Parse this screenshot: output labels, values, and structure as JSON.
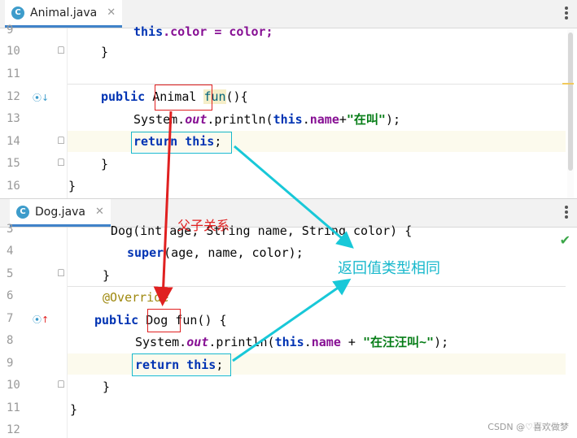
{
  "colors": {
    "keyword": "#0033b3",
    "field": "#871094",
    "string": "#067d17",
    "annotation": "#9e880d",
    "note_red": "#e02020",
    "note_cyan": "#18b8cc"
  },
  "pane_animal": {
    "tab_label": "Animal.java",
    "tab_icon": "C",
    "close_glyph": "✕",
    "line_numbers": [
      "9",
      "10",
      "11",
      "12",
      "13",
      "14",
      "15",
      "16"
    ],
    "lines": {
      "l9_a": "this",
      "l9_b": ".color = color;",
      "l10": "}",
      "l12_kw": "public",
      "l12_type": "Animal",
      "l12_fn": "fun",
      "l12_rest": "(){",
      "l13_a": "System.",
      "l13_out": "out",
      "l13_b": ".println(",
      "l13_this": "this",
      "l13_dot": ".",
      "l13_name": "name",
      "l13_plus": "+",
      "l13_str": "\"在叫\"",
      "l13_end": ");",
      "l14_return": "return",
      "l14_this": "this",
      "l14_end": ";",
      "l15": "}",
      "l16": "}"
    }
  },
  "pane_dog": {
    "tab_label": "Dog.java",
    "tab_icon": "C",
    "close_glyph": "✕",
    "check_glyph": "✔",
    "line_numbers": [
      "3",
      "4",
      "5",
      "6",
      "7",
      "8",
      "9",
      "10",
      "11",
      "12"
    ],
    "lines": {
      "l3": "Dog(int age, String name, String color) {",
      "l4_super": "super",
      "l4_rest": "(age, name, color);",
      "l5": "}",
      "l6": "@Override",
      "l7_kw": "public",
      "l7_type": "Dog",
      "l7_rest": "fun() {",
      "l8_a": "System.",
      "l8_out": "out",
      "l8_b": ".println(",
      "l8_this": "this",
      "l8_dot": ".",
      "l8_name": "name",
      "l8_plus": " + ",
      "l8_str": "\"在汪汪叫~\"",
      "l8_end": ");",
      "l9_return": "return",
      "l9_this": "this",
      "l9_end": ";",
      "l10": "}",
      "l11": "}"
    }
  },
  "annotations": {
    "parent_child": "父子关系",
    "same_return": "返回值类型相同"
  },
  "watermark": "CSDN @♡喜欢做梦"
}
